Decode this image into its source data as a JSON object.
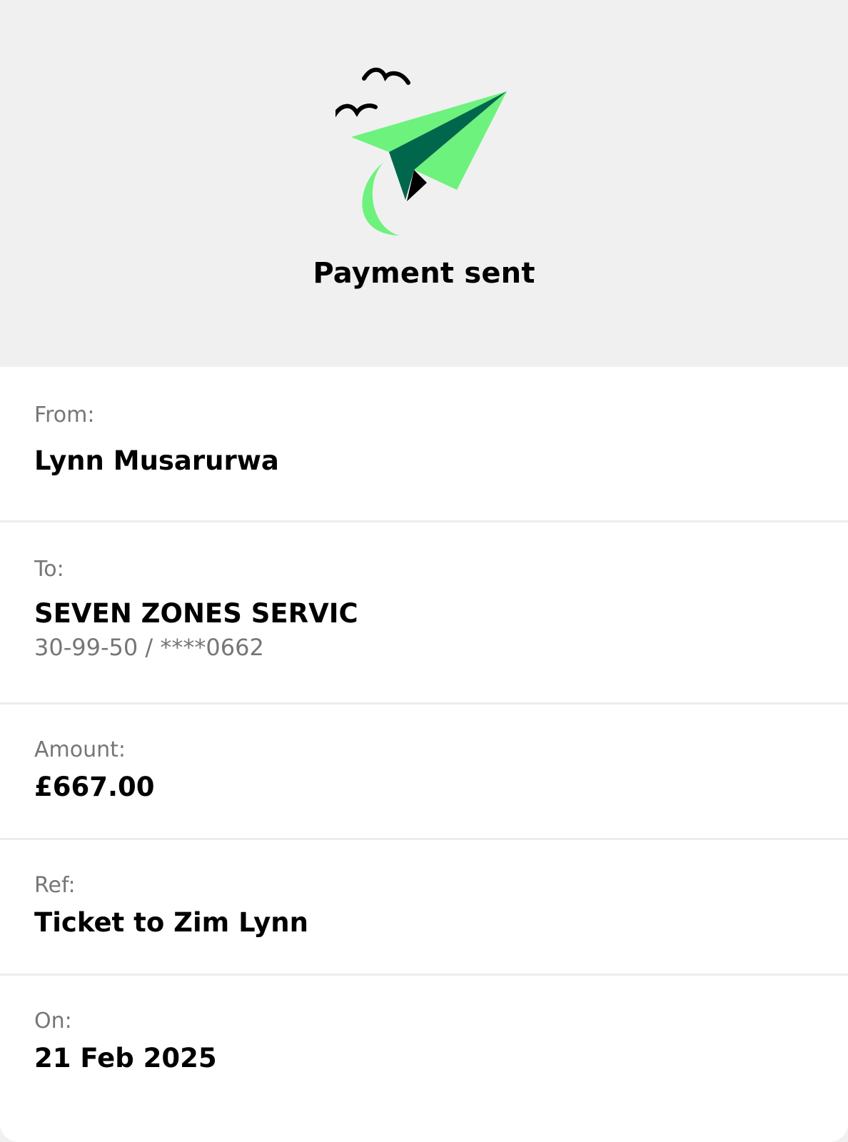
{
  "header": {
    "icon": "paper-plane-icon",
    "title": "Payment sent",
    "colors": {
      "plane_light": "#6df27d",
      "plane_dark": "#00674c",
      "background": "#f0f0f0"
    }
  },
  "details": {
    "from": {
      "label": "From:",
      "value": "Lynn Musarurwa"
    },
    "to": {
      "label": "To:",
      "value": "SEVEN ZONES SERVIC",
      "account": "30-99-50 / ****0662"
    },
    "amount": {
      "label": "Amount:",
      "value": "£667.00"
    },
    "ref": {
      "label": "Ref:",
      "value": "Ticket to Zim Lynn"
    },
    "on": {
      "label": "On:",
      "value": "21 Feb 2025"
    }
  }
}
